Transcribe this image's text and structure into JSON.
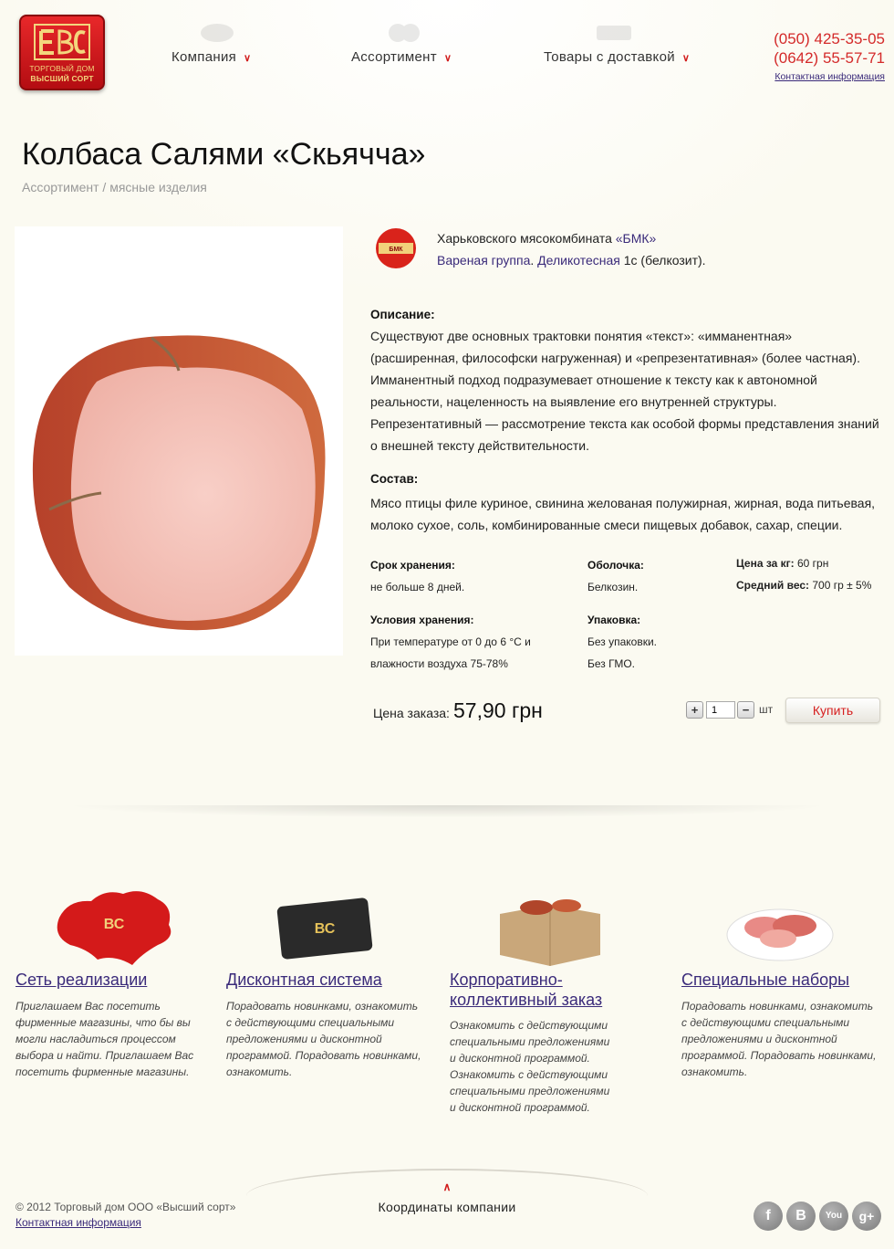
{
  "brand": {
    "logo_line1": "ТОРГОВЫЙ ДОМ",
    "logo_line2": "ВЫСШИЙ СОРТ"
  },
  "nav": [
    {
      "label": "Компания"
    },
    {
      "label": "Ассортимент"
    },
    {
      "label": "Товары с доставкой"
    }
  ],
  "contacts": {
    "phone1": "(050) 425-35-05",
    "phone2": "(0642) 55-57-71",
    "link": "Контактная информация"
  },
  "page": {
    "title": "Колбаса Салями «Скьяччa»",
    "breadcrumb": "Ассортимент / мясные изделия"
  },
  "product": {
    "producer_prefix": "Харьковского мясокомбината",
    "producer_link": "«БМК»",
    "group_link": "Вареная группа",
    "dot": ".",
    "deli_link": "Деликотесная",
    "deli_suffix": "1с (белкозит).",
    "description_title": "Описание:",
    "description": "Существуют две основных трактовки понятия «текст»: «имманентная» (расширенная, философски нагруженная) и «репрезентативная» (более частная). Имманентный подход подразумевает отношение к тексту как к автономной реальности, нацеленность на выявление его внутренней структуры. Репрезентативный — рассмотрение текста как особой формы представления знаний о внешней тексту действительности.",
    "composition_title": "Состав:",
    "composition": "Мясо птицы филе куриное, свинина желованая полужирная, жирная, вода питьевая, молоко сухое, соль, комбинированные смеси пищевых добавок, сахар, специи.",
    "shelf_life_label": "Срок хранения:",
    "shelf_life_value": "не больше 8 дней.",
    "casing_label": "Оболочка:",
    "casing_value": "Белкозин.",
    "price_kg_label": "Цена за кг:",
    "price_kg_value": "60 грн",
    "avg_weight_label": "Средний вес:",
    "avg_weight_value": "700 гр ± 5%",
    "storage_label": "Условия хранения:",
    "storage_value_1": "При температуре от 0 до 6 °С и",
    "storage_value_2": "влажности воздуха 75-78%",
    "packaging_label": "Упаковка:",
    "packaging_value_1": "Без упаковки.",
    "packaging_value_2": "Без ГМО.",
    "order_price_label": "Цена заказа:",
    "order_price_value": "57,90 грн",
    "quantity": "1",
    "unit": "шт",
    "plus": "+",
    "minus": "−",
    "buy_label": "Купить"
  },
  "features": [
    {
      "title": "Сеть реализации",
      "text": "Приглашаем Вас посетить фирменные магазины, что бы вы могли насладиться процессом выбора и найти. Приглашаем Вас посетить фирменные магазины."
    },
    {
      "title": "Дисконтная система",
      "text": "Порадовать новинками, ознакомить с действующими специальными предложениями и дисконтной программой. Порадовать новинками, ознакомить."
    },
    {
      "title": "Корпоративно-коллективный заказ",
      "text": "Ознакомить с действующими специальными предложениями и дисконтной программой. Ознакомить с действующими специальными предложениями и дисконтной программой."
    },
    {
      "title": "Специальные наборы",
      "text": "Порадовать новинками, ознакомить с действующими специальными предложениями и дисконтной программой. Порадовать новинками, ознакомить."
    }
  ],
  "footer": {
    "copyright": "© 2012 Торговый дом ООО «Высший сорт»",
    "contact_link": "Контактная информация",
    "center_link": "Координаты компании",
    "social": [
      "facebook-icon",
      "vkontakte-icon",
      "youtube-icon",
      "google-plus-icon"
    ]
  },
  "colors": {
    "accent_red": "#d42a2a",
    "link": "#3a2a7a",
    "background": "#fbfaf1"
  }
}
